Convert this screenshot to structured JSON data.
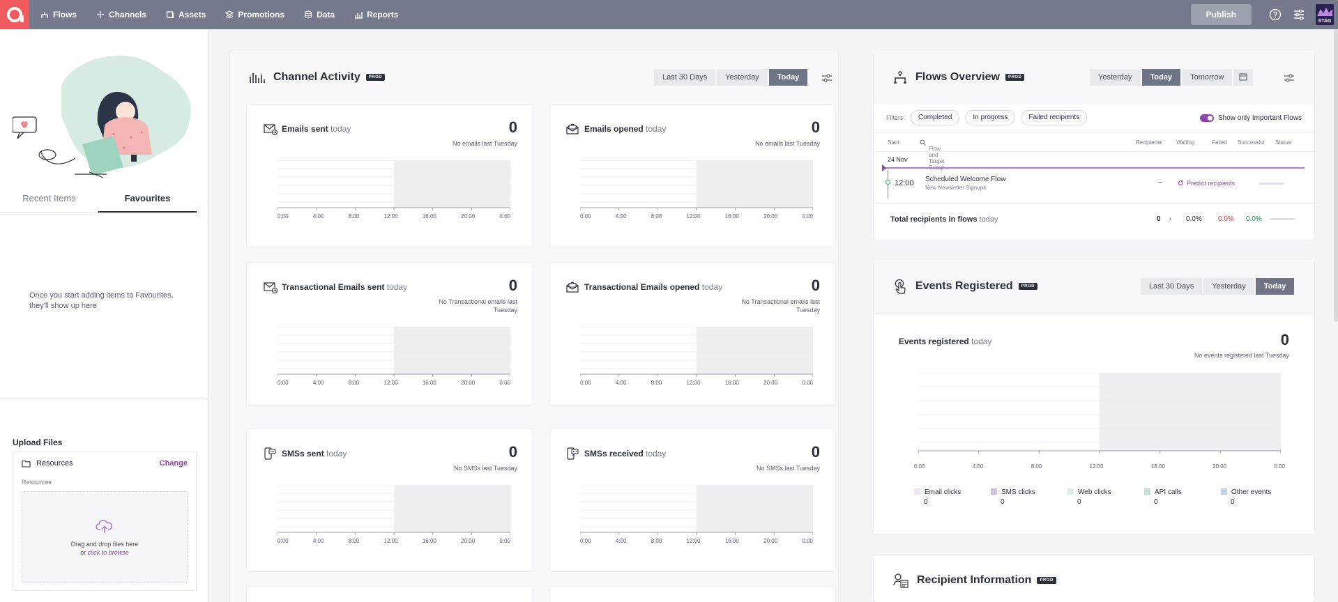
{
  "nav": {
    "items": [
      {
        "label": "Flows",
        "icon": "flows-icon"
      },
      {
        "label": "Channels",
        "icon": "channels-icon"
      },
      {
        "label": "Assets",
        "icon": "assets-icon"
      },
      {
        "label": "Promotions",
        "icon": "promotions-icon"
      },
      {
        "label": "Data",
        "icon": "data-icon"
      },
      {
        "label": "Reports",
        "icon": "reports-icon"
      }
    ],
    "publish_label": "Publish",
    "env_badge": "STAG",
    "brand_color": "#f0595d"
  },
  "sidebar": {
    "tabs": [
      "Recent Items",
      "Favourites"
    ],
    "active_tab": "Favourites",
    "empty_text_1": "Once you start adding items to Favourites,",
    "empty_text_2": "they'll show up here",
    "upload": {
      "title": "Upload Files",
      "folder_label": "Resources",
      "change_label": "Change",
      "path_label": "Resources",
      "drop_text": "Drag and drop files here",
      "drop_or": "or ",
      "drop_browse": "click to browse"
    }
  },
  "channel_activity": {
    "title": "Channel Activity",
    "badge": "PROD",
    "ranges": [
      "Last 30 Days",
      "Yesterday",
      "Today"
    ],
    "active_range": "Today",
    "today_word": "today",
    "x_ticks": [
      "0:00",
      "4:00",
      "8:00",
      "12:00",
      "16:00",
      "20:00",
      "0:00"
    ],
    "metrics": [
      {
        "title": "Emails sent",
        "value": "0",
        "sub": "No emails last Tuesday",
        "icon": "email-sent-icon"
      },
      {
        "title": "Emails opened",
        "value": "0",
        "sub": "No emails last Tuesday",
        "icon": "email-opened-icon"
      },
      {
        "title": "Transactional Emails sent",
        "value": "0",
        "sub": "No Transactional emails last Tuesday",
        "icon": "email-sent-icon"
      },
      {
        "title": "Transactional Emails opened",
        "value": "0",
        "sub": "No Transactional emails last Tuesday",
        "icon": "email-opened-icon"
      },
      {
        "title": "SMSs sent",
        "value": "0",
        "sub": "No SMSs last Tuesday",
        "icon": "sms-sent-icon"
      },
      {
        "title": "SMSs received",
        "value": "0",
        "sub": "No SMSs last Tuesday",
        "icon": "sms-received-icon"
      }
    ]
  },
  "flows_overview": {
    "title": "Flows Overview",
    "badge": "PROD",
    "ranges": [
      "Yesterday",
      "Today",
      "Tomorrow"
    ],
    "active_range": "Today",
    "filters_label": "Filters:",
    "filters": [
      "Completed",
      "In progress",
      "Failed recipients"
    ],
    "toggle_label": "Show only Important Flows",
    "columns": {
      "start": "Start",
      "flow": "Flow and Target Group",
      "recipients": "Recipients",
      "waiting": "Waiting",
      "failed": "Failed",
      "successful": "Successful",
      "status": "Status"
    },
    "date": "24 Nov",
    "flows": [
      {
        "time": "12:00",
        "name": "Scheduled Welcome Flow",
        "group": "New Newsletter Signups",
        "recipients": "–",
        "action": "Predict recipients"
      }
    ],
    "total": {
      "label": "Total recipients in flows",
      "today": "today",
      "count": "0",
      "waiting": "0.0%",
      "failed": "0.0%",
      "successful": "0.0%"
    }
  },
  "events_registered": {
    "title": "Events Registered",
    "badge": "PROD",
    "ranges": [
      "Last 30 Days",
      "Yesterday",
      "Today"
    ],
    "active_range": "Today",
    "chart_title": "Events registered",
    "today_word": "today",
    "value": "0",
    "sub": "No events registered last Tuesday",
    "x_ticks": [
      "0:00",
      "4:00",
      "8:00",
      "12:00",
      "16:00",
      "20:00",
      "0:00"
    ],
    "legend": [
      {
        "label": "Email clicks",
        "value": "0",
        "color": "#efe4f7"
      },
      {
        "label": "SMS clicks",
        "value": "0",
        "color": "#d9b8ec"
      },
      {
        "label": "Web clicks",
        "value": "0",
        "color": "#dcefe6"
      },
      {
        "label": "API calls",
        "value": "0",
        "color": "#bfe3d2"
      },
      {
        "label": "Other events",
        "value": "0",
        "color": "#b9d3f0"
      }
    ]
  },
  "recipient_info": {
    "title": "Recipient Information",
    "badge": "PROD"
  }
}
